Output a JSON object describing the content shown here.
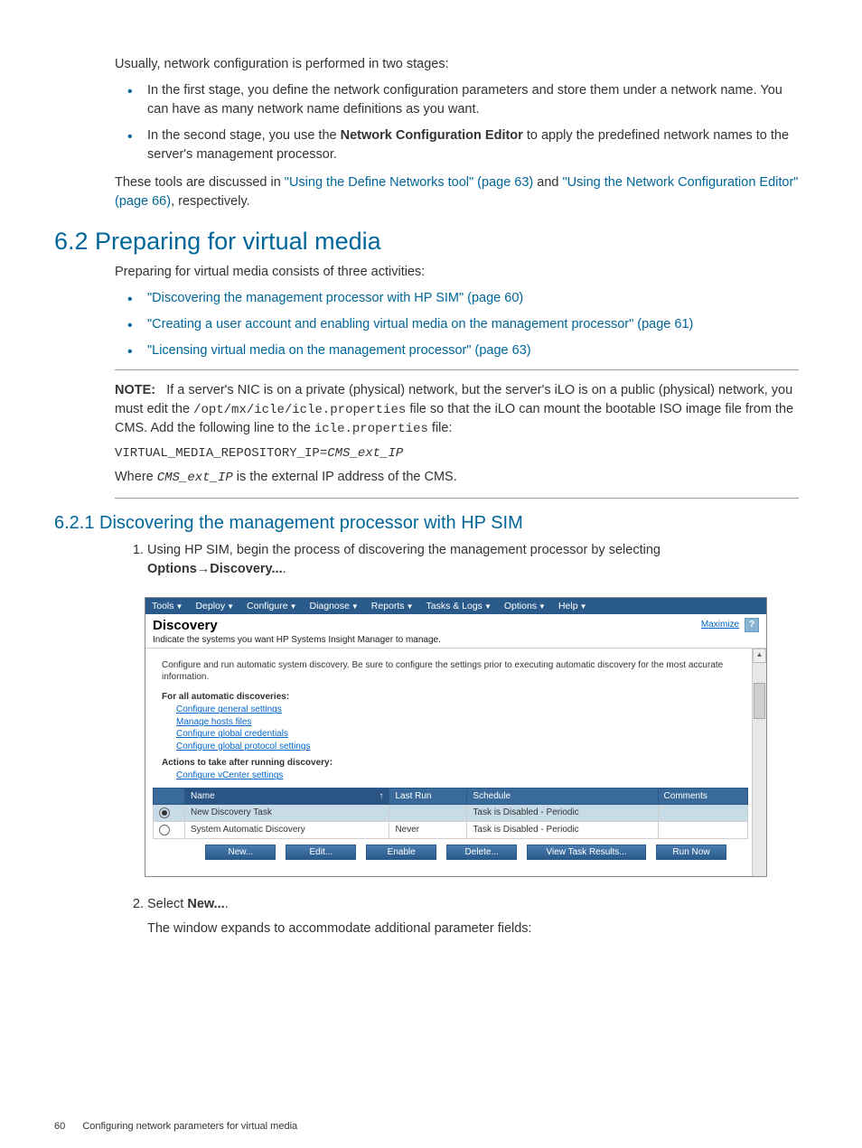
{
  "intro": {
    "p1": "Usually, network configuration is performed in two stages:",
    "bullet1_a": "In the first stage, you define the network configuration parameters and store them under a network name. You can have as many network name definitions as you want.",
    "bullet2_a": "In the second stage, you use the ",
    "bullet2_b": "Network Configuration Editor",
    "bullet2_c": " to apply the predefined network names to the server's management processor.",
    "p2_a": "These tools are discussed in ",
    "p2_link1": "\"Using the Define Networks tool\" (page 63)",
    "p2_b": " and ",
    "p2_link2": "\"Using the Network Configuration Editor\" (page 66)",
    "p2_c": ", respectively."
  },
  "sec62": {
    "heading": "6.2 Preparing for virtual media",
    "p1": "Preparing for virtual media consists of three activities:",
    "link1": "\"Discovering the management processor with HP SIM\" (page 60)",
    "link2": "\"Creating a user account and enabling virtual media on the management processor\" (page 61)",
    "link3": "\"Licensing virtual media on the management processor\" (page 63)"
  },
  "note": {
    "label": "NOTE:",
    "t1": "If a server's NIC is on a private (physical) network, but the server's iLO is on a public (physical) network, you must edit the ",
    "code1": "/opt/mx/icle/icle.properties",
    "t2": " file so that the iLO can mount the bootable ISO image file from the CMS. Add the following line to the ",
    "code2": "icle.properties",
    "t3": " file:",
    "codeline_a": "VIRTUAL_MEDIA_REPOSITORY_IP=",
    "codeline_b": "CMS_ext_IP",
    "p2_a": "Where ",
    "p2_code": "CMS_ext_IP",
    "p2_b": " is the external IP address of the CMS."
  },
  "sec621": {
    "heading": "6.2.1 Discovering the management processor with HP SIM",
    "step1_a": "Using HP SIM, begin the process of discovering the management processor by selecting ",
    "step1_b": "Options",
    "step1_arrow": "→",
    "step1_c": "Discovery...",
    "step1_d": ".",
    "step2_a": "Select ",
    "step2_b": "New...",
    "step2_c": ".",
    "step2_p": "The window expands to accommodate additional parameter fields:"
  },
  "sim": {
    "menu": [
      "Tools",
      "Deploy",
      "Configure",
      "Diagnose",
      "Reports",
      "Tasks & Logs",
      "Options",
      "Help"
    ],
    "title": "Discovery",
    "subtitle": "Indicate the systems you want HP Systems Insight Manager to manage.",
    "maximize": "Maximize",
    "help": "?",
    "info": "Configure and run automatic system discovery. Be sure to configure the settings prior to executing automatic discovery for the most accurate information.",
    "h1": "For all automatic discoveries:",
    "links1": [
      "Configure general settings",
      "Manage hosts files",
      "Configure global credentials",
      "Configure global protocol settings"
    ],
    "h2": "Actions to take after running discovery:",
    "links2": [
      "Configure vCenter settings"
    ],
    "cols": {
      "name": "Name",
      "lastrun": "Last Run",
      "schedule": "Schedule",
      "comments": "Comments"
    },
    "sort_arrow": "↑",
    "rows": [
      {
        "sel": true,
        "name": "New Discovery Task",
        "lastrun": "",
        "schedule": "Task is Disabled - Periodic",
        "comments": ""
      },
      {
        "sel": false,
        "name": "System Automatic Discovery",
        "lastrun": "Never",
        "schedule": "Task is Disabled - Periodic",
        "comments": ""
      }
    ],
    "buttons": [
      "New...",
      "Edit...",
      "Enable",
      "Delete...",
      "View Task Results...",
      "Run Now"
    ]
  },
  "footer": {
    "page": "60",
    "title": "Configuring network parameters for virtual media"
  }
}
